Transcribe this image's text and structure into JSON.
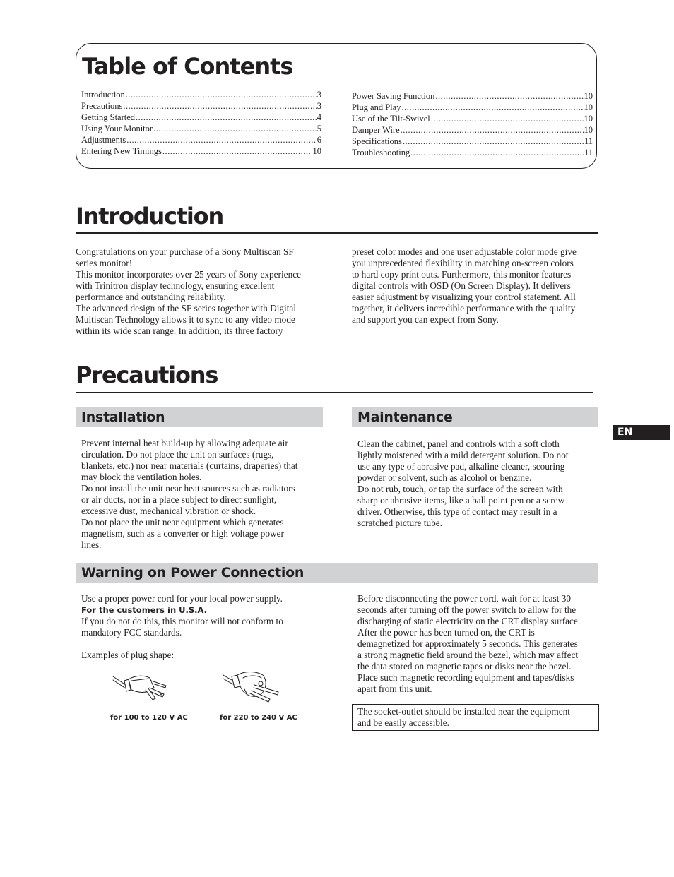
{
  "toc": {
    "title": "Table of Contents",
    "left": [
      {
        "label": "Introduction",
        "page": "3"
      },
      {
        "label": "Precautions",
        "page": "3"
      },
      {
        "label": "Getting Started",
        "page": "4"
      },
      {
        "label": "Using Your Monitor",
        "page": "5"
      },
      {
        "label": "Adjustments",
        "page": "6"
      },
      {
        "label": "Entering New Timings",
        "page": "10"
      }
    ],
    "right": [
      {
        "label": "Power Saving Function",
        "page": "10"
      },
      {
        "label": "Plug and Play",
        "page": "10"
      },
      {
        "label": "Use of the Tilt-Swivel",
        "page": "10"
      },
      {
        "label": "Damper Wire",
        "page": "10"
      },
      {
        "label": "Specifications",
        "page": "11"
      },
      {
        "label": "Troubleshooting",
        "page": "11"
      }
    ]
  },
  "introduction": {
    "title": "Introduction",
    "left_lines": [
      "Congratulations on your purchase of a Sony Multiscan SF",
      "series monitor!",
      "This monitor incorporates over 25 years of Sony experience",
      "with Trinitron display technology, ensuring excellent",
      "performance and outstanding reliability.",
      "The advanced design of the SF series together with Digital",
      "Multiscan Technology allows it to sync to any video mode",
      "within its wide scan range. In addition, its three factory"
    ],
    "right_lines": [
      "preset color modes and one user adjustable color mode give",
      "you unprecedented flexibility in matching on-screen colors",
      "to hard copy print outs. Furthermore, this monitor features",
      "digital controls with OSD (On Screen Display). It delivers",
      "easier adjustment by visualizing your control statement. All",
      "together, it delivers incredible performance with the quality",
      "and support you can expect from Sony."
    ]
  },
  "precautions": {
    "title": "Precautions",
    "installation": {
      "title": "Installation",
      "lines": [
        "Prevent internal heat build-up by allowing adequate air",
        "circulation. Do not place the unit on surfaces (rugs,",
        "blankets, etc.) nor near materials (curtains, draperies) that",
        "may block the ventilation holes.",
        "Do not install the unit near heat sources such as radiators",
        "or air ducts, nor in a place subject to direct sunlight,",
        "excessive dust, mechanical vibration or shock.",
        "Do not place the unit near equipment which generates",
        "magnetism, such as a converter or high voltage power",
        "lines."
      ]
    },
    "maintenance": {
      "title": "Maintenance",
      "lines": [
        "Clean the cabinet, panel and controls with a soft cloth",
        "lightly moistened with a mild detergent solution. Do not",
        "use any type of abrasive pad, alkaline cleaner, scouring",
        "powder or solvent, such as alcohol or benzine.",
        "Do not rub, touch, or tap the surface of the screen with",
        "sharp or abrasive items, like a ball point pen or a screw",
        "driver. Otherwise, this type of contact may result in a",
        "scratched picture tube."
      ]
    },
    "power_warning": {
      "title": "Warning on Power Connection",
      "line1": "Use a proper power cord for your local power supply.",
      "usa_heading": "For the customers in U.S.A.",
      "line2": "If you do not do this, this monitor will not conform to",
      "line3": "mandatory FCC standards.",
      "examples_label": "Examples of plug shape:",
      "plug_us_caption": "for 100 to 120 V AC",
      "plug_eu_caption": "for 220 to 240 V AC",
      "right_lines": [
        "Before disconnecting the power cord, wait for at least 30",
        "seconds after turning off the power switch to allow for the",
        "discharging of static electricity on the CRT display surface.",
        "After the power has been turned on, the CRT is",
        "demagnetized for approximately 5 seconds. This generates",
        "a strong magnetic field around the bezel, which may affect",
        "the data stored on magnetic tapes or disks near the bezel.",
        "Place such magnetic recording equipment and tapes/disks",
        "apart from this unit."
      ],
      "notice_lines": [
        "The socket-outlet should be installed near the equipment",
        "and be easily accessible."
      ]
    }
  },
  "language_tab": "EN"
}
